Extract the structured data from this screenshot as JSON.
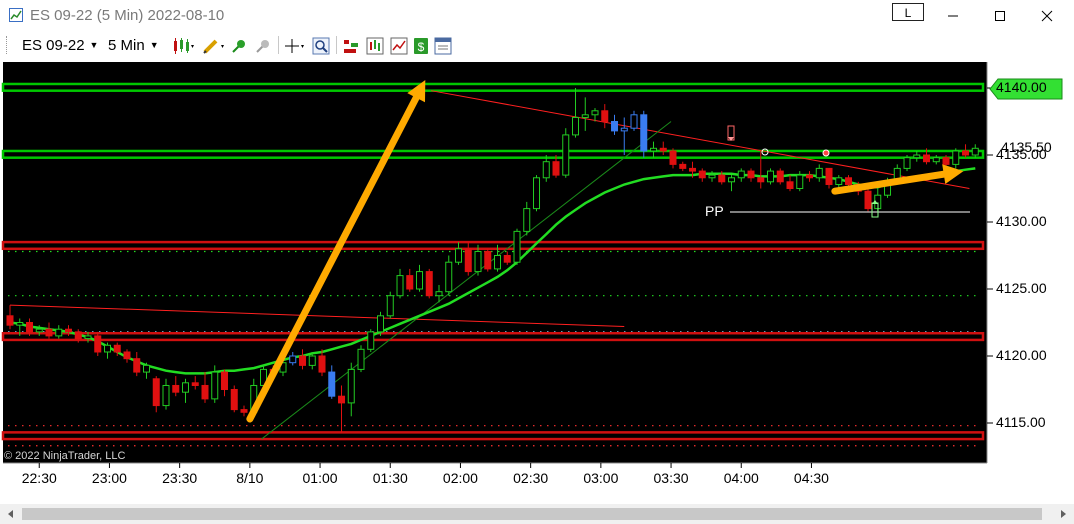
{
  "window": {
    "title": "ES 09-22 (5 Min)  2022-08-10",
    "link_button": "L",
    "minimize_icon": "minimize-icon",
    "maximize_icon": "maximize-icon",
    "close_icon": "close-icon"
  },
  "toolbar": {
    "instrument": "ES 09-22",
    "interval": "5 Min",
    "icons": [
      "bar-type-icon",
      "drawing-tool-icon",
      "pin-icon",
      "unpin-icon",
      "crosshair-icon",
      "zoom-icon",
      "strategies-icon",
      "indicators-icon",
      "chart-trader-icon",
      "dollar-icon",
      "properties-icon"
    ]
  },
  "colors": {
    "background": "#000000",
    "up_candle": "#22cc22",
    "down_candle": "#e01010",
    "blue_candle": "#3a7cf0",
    "moving_average": "#22dd22",
    "green_zone": "#00c800",
    "red_zone": "#d01010",
    "annotation_arrow": "#ffaa00",
    "trendline_red": "#ff2020",
    "trendline_green": "#1a8a1a"
  },
  "chart": {
    "copyright": "© 2022 NinjaTrader, LLC",
    "pp_label": "PP",
    "current_price": "4135.50",
    "y_ticks": [
      "4140.00",
      "4135.00",
      "4130.00",
      "4125.00",
      "4120.00",
      "4115.00"
    ],
    "x_ticks": [
      "22:30",
      "23:00",
      "23:30",
      "8/10",
      "01:00",
      "01:30",
      "02:00",
      "02:30",
      "03:00",
      "03:30",
      "04:00",
      "04:30"
    ]
  },
  "chart_data": {
    "type": "candlestick",
    "instrument": "ES 09-22",
    "interval": "5 Min",
    "ylim": [
      4112.5,
      4142.5
    ],
    "current_price": 4135.5,
    "pivot_point": 4130.8,
    "y_ticks": [
      4140,
      4135,
      4130,
      4125,
      4120,
      4115
    ],
    "x_tick_labels": [
      "22:30",
      "23:00",
      "23:30",
      "8/10",
      "01:00",
      "01:30",
      "02:00",
      "02:30",
      "03:00",
      "03:30",
      "04:00",
      "04:30"
    ],
    "x_tick_index": [
      5,
      17,
      29,
      41,
      53,
      65,
      77,
      89,
      101,
      113,
      125,
      137
    ],
    "zones": [
      {
        "color": "green",
        "low": 4139.8,
        "high": 4140.3
      },
      {
        "color": "green",
        "low": 4134.8,
        "high": 4135.3
      },
      {
        "color": "red",
        "low": 4128.0,
        "high": 4128.5
      },
      {
        "color": "red",
        "low": 4121.2,
        "high": 4121.7
      },
      {
        "color": "red",
        "low": 4113.8,
        "high": 4114.3
      }
    ],
    "candles": [
      [
        4123.0,
        4123.8,
        4122.0,
        4122.3
      ],
      [
        4122.3,
        4122.8,
        4121.5,
        4122.5
      ],
      [
        4122.5,
        4122.8,
        4121.5,
        4121.8
      ],
      [
        4121.8,
        4122.3,
        4121.5,
        4122.0
      ],
      [
        4122.0,
        4122.5,
        4121.3,
        4121.5
      ],
      [
        4121.5,
        4122.3,
        4121.3,
        4122.0
      ],
      [
        4122.0,
        4122.3,
        4121.5,
        4121.8
      ],
      [
        4121.8,
        4122.0,
        4121.0,
        4121.3
      ],
      [
        4121.3,
        4121.8,
        4121.0,
        4121.5
      ],
      [
        4121.5,
        4121.8,
        4120.0,
        4120.3
      ],
      [
        4120.3,
        4121.0,
        4119.8,
        4120.8
      ],
      [
        4120.8,
        4121.0,
        4120.0,
        4120.3
      ],
      [
        4120.3,
        4120.5,
        4119.5,
        4119.8
      ],
      [
        4119.8,
        4120.3,
        4118.5,
        4118.8
      ],
      [
        4118.8,
        4119.5,
        4118.3,
        4119.3
      ],
      [
        4118.3,
        4118.5,
        4115.8,
        4116.3
      ],
      [
        4116.3,
        4118.3,
        4116.0,
        4117.8
      ],
      [
        4117.8,
        4118.5,
        4117.0,
        4117.3
      ],
      [
        4117.3,
        4118.3,
        4116.5,
        4118.0
      ],
      [
        4118.0,
        4118.5,
        4117.5,
        4117.8
      ],
      [
        4117.8,
        4118.8,
        4116.5,
        4116.8
      ],
      [
        4116.8,
        4119.3,
        4116.5,
        4118.8
      ],
      [
        4118.8,
        4119.0,
        4117.0,
        4117.5
      ],
      [
        4117.5,
        4117.8,
        4115.8,
        4116.0
      ],
      [
        4116.0,
        4116.3,
        4115.5,
        4115.8
      ],
      [
        4115.8,
        4118.3,
        4115.5,
        4117.8
      ],
      [
        4117.8,
        4119.3,
        4117.5,
        4119.0
      ],
      [
        4119.0,
        4119.3,
        4118.5,
        4118.8
      ],
      [
        4118.8,
        4120.0,
        4118.5,
        4119.5
      ],
      [
        4119.5,
        4120.3,
        4119.3,
        4120.0
      ],
      [
        4120.0,
        4120.5,
        4119.0,
        4119.3
      ],
      [
        4119.3,
        4120.3,
        4119.0,
        4120.0
      ],
      [
        4120.0,
        4120.5,
        4118.5,
        4118.8
      ],
      [
        4118.8,
        4119.3,
        4116.8,
        4117.0
      ],
      [
        4117.0,
        4117.8,
        4114.3,
        4116.5
      ],
      [
        4116.5,
        4119.5,
        4115.5,
        4119.0
      ],
      [
        4119.0,
        4120.8,
        4118.8,
        4120.5
      ],
      [
        4120.5,
        4122.0,
        4120.3,
        4121.8
      ],
      [
        4121.8,
        4123.3,
        4121.5,
        4123.0
      ],
      [
        4123.0,
        4124.8,
        4122.8,
        4124.5
      ],
      [
        4124.5,
        4126.5,
        4124.3,
        4126.0
      ],
      [
        4126.0,
        4126.5,
        4124.8,
        4125.0
      ],
      [
        4125.0,
        4126.8,
        4124.8,
        4126.3
      ],
      [
        4126.3,
        4126.5,
        4124.3,
        4124.5
      ],
      [
        4124.5,
        4125.3,
        4124.0,
        4124.8
      ],
      [
        4124.8,
        4127.5,
        4124.5,
        4127.0
      ],
      [
        4127.0,
        4128.5,
        4126.8,
        4128.0
      ],
      [
        4128.0,
        4128.5,
        4126.0,
        4126.3
      ],
      [
        4126.3,
        4128.3,
        4126.0,
        4127.8
      ],
      [
        4127.8,
        4128.0,
        4126.3,
        4126.5
      ],
      [
        4126.5,
        4128.3,
        4126.3,
        4127.5
      ],
      [
        4127.5,
        4127.8,
        4126.8,
        4127.0
      ],
      [
        4127.0,
        4129.5,
        4126.8,
        4129.3
      ],
      [
        4129.3,
        4131.5,
        4129.0,
        4131.0
      ],
      [
        4131.0,
        4133.5,
        4130.8,
        4133.3
      ],
      [
        4133.3,
        4135.0,
        4133.0,
        4134.5
      ],
      [
        4134.5,
        4135.0,
        4133.3,
        4133.5
      ],
      [
        4133.5,
        4137.0,
        4133.3,
        4136.5
      ],
      [
        4136.5,
        4140.0,
        4136.3,
        4137.8
      ],
      [
        4137.8,
        4139.3,
        4136.8,
        4138.0
      ],
      [
        4138.0,
        4138.5,
        4137.5,
        4138.3
      ],
      [
        4138.3,
        4138.8,
        4137.0,
        4137.5
      ],
      [
        4137.5,
        4138.0,
        4136.5,
        4136.8
      ],
      [
        4136.8,
        4137.8,
        4135.0,
        4137.0
      ],
      [
        4137.0,
        4138.3,
        4136.8,
        4138.0
      ],
      [
        4138.0,
        4138.3,
        4134.8,
        4135.3
      ],
      [
        4135.3,
        4136.0,
        4134.8,
        4135.5
      ],
      [
        4135.5,
        4136.0,
        4135.0,
        4135.3
      ],
      [
        4135.3,
        4135.5,
        4134.0,
        4134.3
      ],
      [
        4134.3,
        4134.5,
        4133.8,
        4134.0
      ],
      [
        4134.0,
        4134.5,
        4133.3,
        4133.8
      ],
      [
        4133.8,
        4134.0,
        4133.0,
        4133.3
      ],
      [
        4133.3,
        4133.8,
        4133.0,
        4133.5
      ],
      [
        4133.5,
        4133.8,
        4132.8,
        4133.0
      ],
      [
        4133.0,
        4133.5,
        4132.3,
        4133.3
      ],
      [
        4133.3,
        4134.0,
        4133.0,
        4133.8
      ],
      [
        4133.8,
        4134.0,
        4133.0,
        4133.3
      ],
      [
        4133.3,
        4135.3,
        4132.5,
        4133.0
      ],
      [
        4133.0,
        4134.0,
        4132.8,
        4133.8
      ],
      [
        4133.8,
        4134.0,
        4132.8,
        4133.0
      ],
      [
        4133.0,
        4133.5,
        4132.3,
        4132.5
      ],
      [
        4132.5,
        4133.8,
        4132.3,
        4133.5
      ],
      [
        4133.5,
        4133.8,
        4133.0,
        4133.3
      ],
      [
        4133.3,
        4134.3,
        4133.0,
        4134.0
      ],
      [
        4134.0,
        4134.0,
        4132.5,
        4132.8
      ],
      [
        4132.8,
        4133.5,
        4132.3,
        4133.3
      ],
      [
        4133.3,
        4133.5,
        4132.5,
        4132.8
      ],
      [
        4132.8,
        4133.0,
        4132.0,
        4132.3
      ],
      [
        4132.3,
        4132.5,
        4130.8,
        4131.0
      ],
      [
        4131.0,
        4132.5,
        4130.8,
        4132.0
      ],
      [
        4132.0,
        4133.3,
        4131.8,
        4133.0
      ],
      [
        4133.0,
        4134.3,
        4132.8,
        4134.0
      ],
      [
        4134.0,
        4135.0,
        4133.8,
        4134.8
      ],
      [
        4134.8,
        4135.3,
        4134.5,
        4135.0
      ],
      [
        4135.0,
        4135.5,
        4134.3,
        4134.5
      ],
      [
        4134.5,
        4135.0,
        4134.3,
        4134.8
      ],
      [
        4134.8,
        4135.0,
        4134.0,
        4134.3
      ],
      [
        4134.3,
        4135.5,
        4134.0,
        4135.3
      ],
      [
        4135.3,
        4135.8,
        4134.8,
        4135.0
      ],
      [
        4135.0,
        4135.8,
        4134.8,
        4135.5
      ]
    ],
    "moving_average": [
      4122.5,
      4122.4,
      4122.2,
      4122.1,
      4122.0,
      4121.9,
      4121.8,
      4121.6,
      4121.4,
      4121.1,
      4120.7,
      4120.3,
      4119.9,
      4119.6,
      4119.3,
      4119.1,
      4118.9,
      4118.8,
      4118.7,
      4118.7,
      4118.7,
      4118.8,
      4118.9,
      4118.9,
      4119.0,
      4119.1,
      4119.3,
      4119.5,
      4119.7,
      4119.9,
      4120.0,
      4120.2,
      4120.3,
      4120.5,
      4120.7,
      4120.9,
      4121.2,
      4121.5,
      4121.8,
      4122.1,
      4122.4,
      4122.7,
      4123.0,
      4123.3,
      4123.6,
      4123.9,
      4124.3,
      4124.7,
      4125.1,
      4125.5,
      4125.9,
      4126.4,
      4127.0,
      4127.7,
      4128.4,
      4129.1,
      4129.8,
      4130.4,
      4130.9,
      4131.4,
      4131.8,
      4132.2,
      4132.5,
      4132.8,
      4133.0,
      4133.2,
      4133.3,
      4133.4,
      4133.5,
      4133.5,
      4133.5,
      4133.6,
      4133.6,
      4133.6,
      4133.6,
      4133.5,
      4133.5,
      4133.4,
      4133.4,
      4133.4,
      4133.5,
      4133.5,
      4133.5,
      4133.4,
      4133.3,
      4133.2,
      4133.0,
      4132.8,
      4132.6,
      4132.6,
      4132.8,
      4133.0,
      4133.2,
      4133.4,
      4133.5,
      4133.6,
      4133.7,
      4133.8,
      4133.9,
      4134.0
    ],
    "horizontal_levels": [
      {
        "price": 4121.8,
        "color": "cyan",
        "style": "dotted"
      },
      {
        "price": 4124.5,
        "color": "green",
        "style": "dotted"
      },
      {
        "price": 4127.8,
        "color": "green",
        "style": "dotted"
      },
      {
        "price": 4114.8,
        "color": "red",
        "style": "dotted"
      },
      {
        "price": 4113.3,
        "color": "red",
        "style": "dotted"
      }
    ],
    "trendlines": [
      {
        "color": "red",
        "from": [
          0,
          4123.8
        ],
        "to": [
          105,
          4122.2
        ]
      },
      {
        "color": "red",
        "from": [
          72,
          4139.8
        ],
        "to": [
          164,
          4132.5
        ]
      },
      {
        "color": "green",
        "from": [
          43,
          4113.8
        ],
        "to": [
          113,
          4137.5
        ]
      }
    ],
    "annotations": [
      {
        "type": "arrow",
        "color": "orange",
        "from": [
          41,
          4115.3
        ],
        "to": [
          71,
          4140.6
        ]
      },
      {
        "type": "arrow",
        "color": "orange",
        "from": [
          141,
          4132.3
        ],
        "to": [
          163,
          4133.8
        ]
      }
    ]
  }
}
